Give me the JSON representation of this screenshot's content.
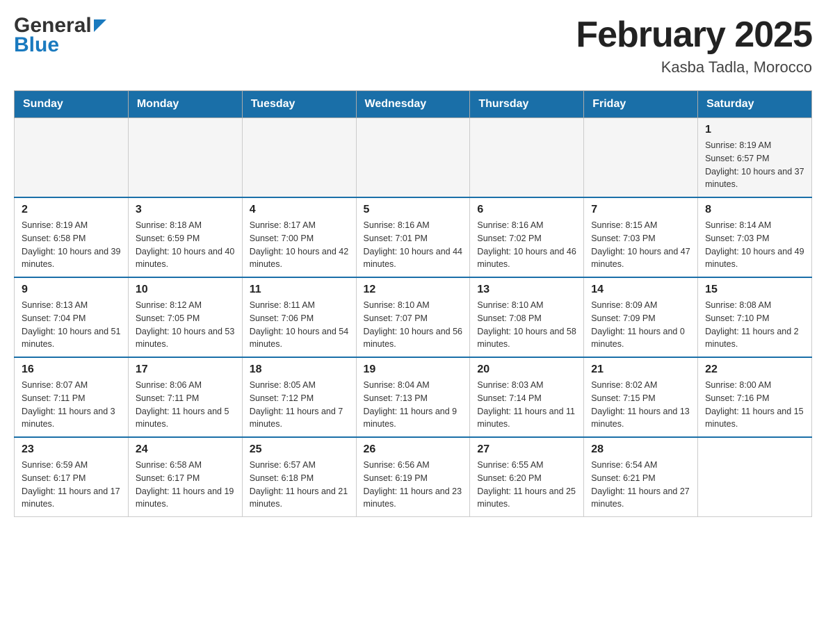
{
  "header": {
    "logo_general": "General",
    "logo_blue": "Blue",
    "month_title": "February 2025",
    "location": "Kasba Tadla, Morocco"
  },
  "days_of_week": [
    "Sunday",
    "Monday",
    "Tuesday",
    "Wednesday",
    "Thursday",
    "Friday",
    "Saturday"
  ],
  "weeks": [
    {
      "days": [
        {
          "date": "",
          "info": ""
        },
        {
          "date": "",
          "info": ""
        },
        {
          "date": "",
          "info": ""
        },
        {
          "date": "",
          "info": ""
        },
        {
          "date": "",
          "info": ""
        },
        {
          "date": "",
          "info": ""
        },
        {
          "date": "1",
          "info": "Sunrise: 8:19 AM\nSunset: 6:57 PM\nDaylight: 10 hours and 37 minutes."
        }
      ]
    },
    {
      "days": [
        {
          "date": "2",
          "info": "Sunrise: 8:19 AM\nSunset: 6:58 PM\nDaylight: 10 hours and 39 minutes."
        },
        {
          "date": "3",
          "info": "Sunrise: 8:18 AM\nSunset: 6:59 PM\nDaylight: 10 hours and 40 minutes."
        },
        {
          "date": "4",
          "info": "Sunrise: 8:17 AM\nSunset: 7:00 PM\nDaylight: 10 hours and 42 minutes."
        },
        {
          "date": "5",
          "info": "Sunrise: 8:16 AM\nSunset: 7:01 PM\nDaylight: 10 hours and 44 minutes."
        },
        {
          "date": "6",
          "info": "Sunrise: 8:16 AM\nSunset: 7:02 PM\nDaylight: 10 hours and 46 minutes."
        },
        {
          "date": "7",
          "info": "Sunrise: 8:15 AM\nSunset: 7:03 PM\nDaylight: 10 hours and 47 minutes."
        },
        {
          "date": "8",
          "info": "Sunrise: 8:14 AM\nSunset: 7:03 PM\nDaylight: 10 hours and 49 minutes."
        }
      ]
    },
    {
      "days": [
        {
          "date": "9",
          "info": "Sunrise: 8:13 AM\nSunset: 7:04 PM\nDaylight: 10 hours and 51 minutes."
        },
        {
          "date": "10",
          "info": "Sunrise: 8:12 AM\nSunset: 7:05 PM\nDaylight: 10 hours and 53 minutes."
        },
        {
          "date": "11",
          "info": "Sunrise: 8:11 AM\nSunset: 7:06 PM\nDaylight: 10 hours and 54 minutes."
        },
        {
          "date": "12",
          "info": "Sunrise: 8:10 AM\nSunset: 7:07 PM\nDaylight: 10 hours and 56 minutes."
        },
        {
          "date": "13",
          "info": "Sunrise: 8:10 AM\nSunset: 7:08 PM\nDaylight: 10 hours and 58 minutes."
        },
        {
          "date": "14",
          "info": "Sunrise: 8:09 AM\nSunset: 7:09 PM\nDaylight: 11 hours and 0 minutes."
        },
        {
          "date": "15",
          "info": "Sunrise: 8:08 AM\nSunset: 7:10 PM\nDaylight: 11 hours and 2 minutes."
        }
      ]
    },
    {
      "days": [
        {
          "date": "16",
          "info": "Sunrise: 8:07 AM\nSunset: 7:11 PM\nDaylight: 11 hours and 3 minutes."
        },
        {
          "date": "17",
          "info": "Sunrise: 8:06 AM\nSunset: 7:11 PM\nDaylight: 11 hours and 5 minutes."
        },
        {
          "date": "18",
          "info": "Sunrise: 8:05 AM\nSunset: 7:12 PM\nDaylight: 11 hours and 7 minutes."
        },
        {
          "date": "19",
          "info": "Sunrise: 8:04 AM\nSunset: 7:13 PM\nDaylight: 11 hours and 9 minutes."
        },
        {
          "date": "20",
          "info": "Sunrise: 8:03 AM\nSunset: 7:14 PM\nDaylight: 11 hours and 11 minutes."
        },
        {
          "date": "21",
          "info": "Sunrise: 8:02 AM\nSunset: 7:15 PM\nDaylight: 11 hours and 13 minutes."
        },
        {
          "date": "22",
          "info": "Sunrise: 8:00 AM\nSunset: 7:16 PM\nDaylight: 11 hours and 15 minutes."
        }
      ]
    },
    {
      "days": [
        {
          "date": "23",
          "info": "Sunrise: 6:59 AM\nSunset: 6:17 PM\nDaylight: 11 hours and 17 minutes."
        },
        {
          "date": "24",
          "info": "Sunrise: 6:58 AM\nSunset: 6:17 PM\nDaylight: 11 hours and 19 minutes."
        },
        {
          "date": "25",
          "info": "Sunrise: 6:57 AM\nSunset: 6:18 PM\nDaylight: 11 hours and 21 minutes."
        },
        {
          "date": "26",
          "info": "Sunrise: 6:56 AM\nSunset: 6:19 PM\nDaylight: 11 hours and 23 minutes."
        },
        {
          "date": "27",
          "info": "Sunrise: 6:55 AM\nSunset: 6:20 PM\nDaylight: 11 hours and 25 minutes."
        },
        {
          "date": "28",
          "info": "Sunrise: 6:54 AM\nSunset: 6:21 PM\nDaylight: 11 hours and 27 minutes."
        },
        {
          "date": "",
          "info": ""
        }
      ]
    }
  ]
}
